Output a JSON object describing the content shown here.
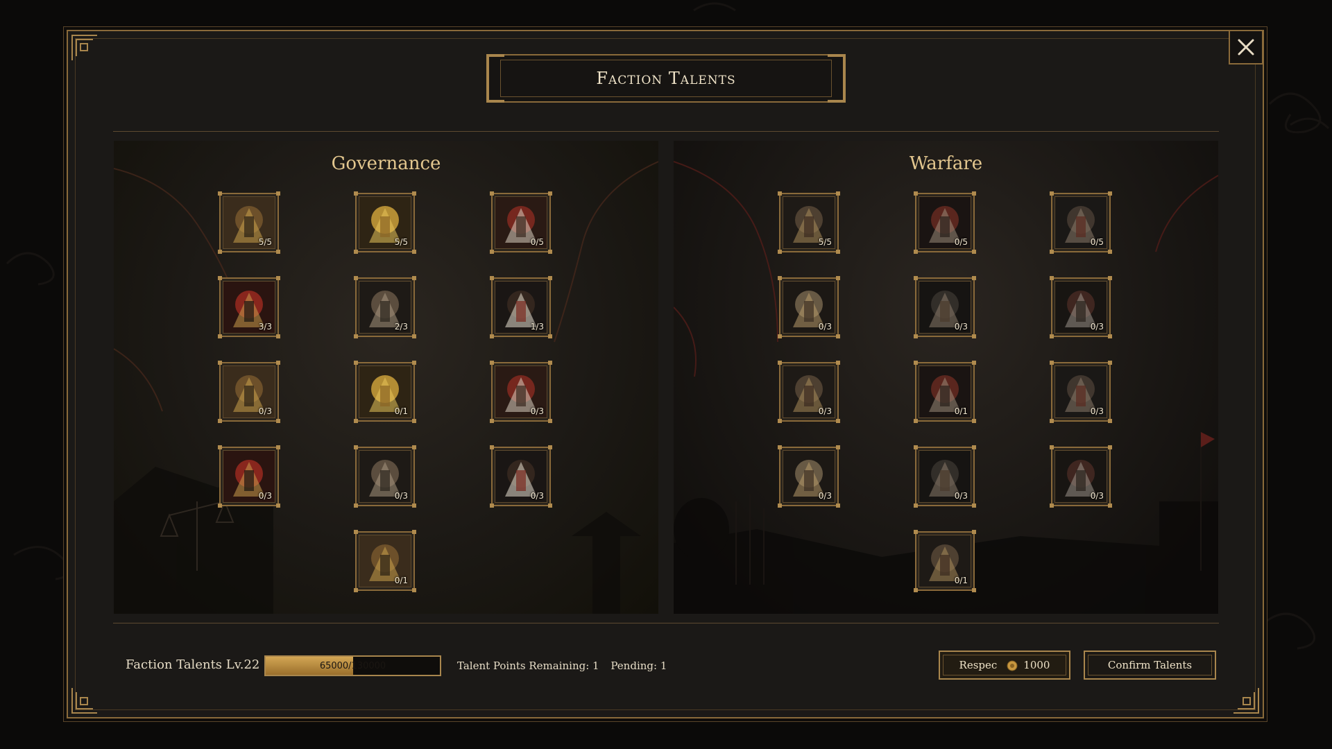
{
  "title": "Faction Talents",
  "panels": {
    "governance": {
      "title": "Governance",
      "talents": [
        {
          "icon": "armored-general-icon",
          "level": "5/5"
        },
        {
          "icon": "wheat-sheaf-icon",
          "level": "5/5"
        },
        {
          "icon": "merchant-cart-icon",
          "level": "0/5"
        },
        {
          "icon": "coin-scales-icon",
          "level": "3/3"
        },
        {
          "icon": "treasure-cart-icon",
          "level": "2/3"
        },
        {
          "icon": "white-horse-icon",
          "level": "1/3"
        },
        {
          "icon": "scribe-hand-icon",
          "level": "0/3"
        },
        {
          "icon": "palace-light-icon",
          "level": "0/1"
        },
        {
          "icon": "lantern-road-icon",
          "level": "0/3"
        },
        {
          "icon": "justice-scales-icon",
          "level": "0/3"
        },
        {
          "icon": "official-curtain-icon",
          "level": "0/3"
        },
        {
          "icon": "candle-study-icon",
          "level": "0/3"
        },
        {
          "icon": "silver-hand-icon",
          "level": "0/1"
        }
      ]
    },
    "warfare": {
      "title": "Warfare",
      "talents": [
        {
          "icon": "tiger-standard-icon",
          "level": "5/5"
        },
        {
          "icon": "war-drum-icon",
          "level": "0/5"
        },
        {
          "icon": "forge-hammer-icon",
          "level": "0/5"
        },
        {
          "icon": "supply-wagon-icon",
          "level": "0/3"
        },
        {
          "icon": "trident-stand-icon",
          "level": "0/3"
        },
        {
          "icon": "lamellar-armor-icon",
          "level": "0/3"
        },
        {
          "icon": "armor-set-icon",
          "level": "0/3"
        },
        {
          "icon": "halberd-icon",
          "level": "0/1"
        },
        {
          "icon": "arrow-volley-icon",
          "level": "0/3"
        },
        {
          "icon": "siege-ram-icon",
          "level": "0/3"
        },
        {
          "icon": "army-tent-icon",
          "level": "0/3"
        },
        {
          "icon": "shield-wall-icon",
          "level": "0/3"
        },
        {
          "icon": "warrior-helmets-icon",
          "level": "0/1"
        }
      ]
    }
  },
  "footer": {
    "level_label": "Faction Talents Lv.22",
    "progress_text": "65000/130000",
    "progress_fraction": 0.5,
    "points_remaining": "Talent Points Remaining: 1",
    "pending": "Pending: 1",
    "respec_label": "Respec",
    "respec_cost": "1000",
    "confirm_label": "Confirm Talents"
  },
  "colors": {
    "gold": "#a9864d",
    "panel_title": "#e3c78f",
    "progress_fill": "#d3a654"
  }
}
